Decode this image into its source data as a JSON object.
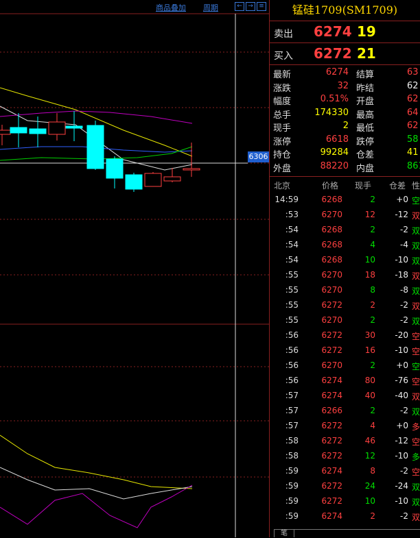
{
  "toolbar": {
    "overlay_label": "商品叠加",
    "period_label": "周期",
    "btn_left": "←",
    "btn_right": "→",
    "btn_menu": "≡"
  },
  "chart": {
    "current_price_tag": "6306"
  },
  "panel": {
    "title": "锰硅1709(SM1709)",
    "ask": {
      "label": "卖出",
      "price": "6274",
      "volume": "19"
    },
    "bid": {
      "label": "买入",
      "price": "6272",
      "volume": "21"
    },
    "stats": [
      {
        "l1": "最新",
        "v1": "6274",
        "c1": "red",
        "l2": "结算",
        "v2": "63",
        "c2": "red"
      },
      {
        "l1": "涨跌",
        "v1": "32",
        "c1": "red",
        "l2": "昨结",
        "v2": "62",
        "c2": "white"
      },
      {
        "l1": "幅度",
        "v1": "0.51%",
        "c1": "red",
        "l2": "开盘",
        "v2": "62",
        "c2": "red"
      },
      {
        "l1": "总手",
        "v1": "174330",
        "c1": "yellow",
        "l2": "最高",
        "v2": "64",
        "c2": "red"
      },
      {
        "l1": "现手",
        "v1": "2",
        "c1": "yellow",
        "l2": "最低",
        "v2": "62",
        "c2": "red"
      },
      {
        "l1": "涨停",
        "v1": "6618",
        "c1": "red",
        "l2": "跌停",
        "v2": "58",
        "c2": "green"
      },
      {
        "l1": "持仓",
        "v1": "99284",
        "c1": "yellow",
        "l2": "仓差",
        "v2": "41",
        "c2": "yellow"
      },
      {
        "l1": "外盘",
        "v1": "88220",
        "c1": "red",
        "l2": "内盘",
        "v2": "861",
        "c2": "green"
      }
    ],
    "tick_headers": {
      "time": "北京",
      "price": "价格",
      "vol": "现手",
      "oi": "仓差",
      "nature": "性"
    },
    "ticks": [
      {
        "time": "14:59",
        "price": "6268",
        "vol": "2",
        "vc": "green",
        "oi": "+0",
        "oc": "white",
        "nat": "空",
        "nc": "green"
      },
      {
        "time": ":53",
        "price": "6270",
        "vol": "12",
        "vc": "red",
        "oi": "-12",
        "oc": "white",
        "nat": "双",
        "nc": "red"
      },
      {
        "time": ":54",
        "price": "6268",
        "vol": "2",
        "vc": "green",
        "oi": "-2",
        "oc": "white",
        "nat": "双",
        "nc": "green"
      },
      {
        "time": ":54",
        "price": "6268",
        "vol": "4",
        "vc": "green",
        "oi": "-4",
        "oc": "white",
        "nat": "双",
        "nc": "green"
      },
      {
        "time": ":54",
        "price": "6268",
        "vol": "10",
        "vc": "green",
        "oi": "-10",
        "oc": "white",
        "nat": "双",
        "nc": "green"
      },
      {
        "time": ":55",
        "price": "6270",
        "vol": "18",
        "vc": "red",
        "oi": "-18",
        "oc": "white",
        "nat": "双",
        "nc": "red"
      },
      {
        "time": ":55",
        "price": "6270",
        "vol": "8",
        "vc": "green",
        "oi": "-8",
        "oc": "white",
        "nat": "双",
        "nc": "green"
      },
      {
        "time": ":55",
        "price": "6272",
        "vol": "2",
        "vc": "red",
        "oi": "-2",
        "oc": "white",
        "nat": "双",
        "nc": "red"
      },
      {
        "time": ":55",
        "price": "6270",
        "vol": "2",
        "vc": "green",
        "oi": "-2",
        "oc": "white",
        "nat": "双",
        "nc": "green"
      },
      {
        "time": ":56",
        "price": "6272",
        "vol": "30",
        "vc": "red",
        "oi": "-20",
        "oc": "white",
        "nat": "空",
        "nc": "red"
      },
      {
        "time": ":56",
        "price": "6272",
        "vol": "16",
        "vc": "red",
        "oi": "-10",
        "oc": "white",
        "nat": "空",
        "nc": "red"
      },
      {
        "time": ":56",
        "price": "6270",
        "vol": "2",
        "vc": "green",
        "oi": "+0",
        "oc": "white",
        "nat": "空",
        "nc": "green"
      },
      {
        "time": ":56",
        "price": "6274",
        "vol": "80",
        "vc": "red",
        "oi": "-76",
        "oc": "white",
        "nat": "空",
        "nc": "red"
      },
      {
        "time": ":57",
        "price": "6274",
        "vol": "40",
        "vc": "red",
        "oi": "-40",
        "oc": "white",
        "nat": "双",
        "nc": "red"
      },
      {
        "time": ":57",
        "price": "6266",
        "vol": "2",
        "vc": "green",
        "oi": "-2",
        "oc": "white",
        "nat": "双",
        "nc": "green"
      },
      {
        "time": ":57",
        "price": "6272",
        "vol": "4",
        "vc": "red",
        "oi": "+0",
        "oc": "white",
        "nat": "多",
        "nc": "red"
      },
      {
        "time": ":58",
        "price": "6272",
        "vol": "46",
        "vc": "red",
        "oi": "-12",
        "oc": "white",
        "nat": "空",
        "nc": "red"
      },
      {
        "time": ":58",
        "price": "6272",
        "vol": "12",
        "vc": "green",
        "oi": "-10",
        "oc": "white",
        "nat": "多",
        "nc": "green"
      },
      {
        "time": ":59",
        "price": "6274",
        "vol": "8",
        "vc": "red",
        "oi": "-2",
        "oc": "white",
        "nat": "空",
        "nc": "red"
      },
      {
        "time": ":59",
        "price": "6272",
        "vol": "24",
        "vc": "green",
        "oi": "-24",
        "oc": "white",
        "nat": "双",
        "nc": "green"
      },
      {
        "time": ":59",
        "price": "6272",
        "vol": "10",
        "vc": "green",
        "oi": "-10",
        "oc": "white",
        "nat": "双",
        "nc": "green"
      },
      {
        "time": ":59",
        "price": "6274",
        "vol": "2",
        "vc": "red",
        "oi": "-2",
        "oc": "white",
        "nat": "双",
        "nc": "red"
      }
    ],
    "bottom_tab": "笔"
  },
  "colors": {
    "up": "#ff4040",
    "down": "#00ffff",
    "grid": "#8a2020",
    "panel_border": "#8a2020",
    "ma_yellow": "#e8e800",
    "ma_white": "#dddddd",
    "ma_magenta": "#c000c0",
    "ma_green": "#00d000",
    "ma_blue": "#3060ff"
  }
}
